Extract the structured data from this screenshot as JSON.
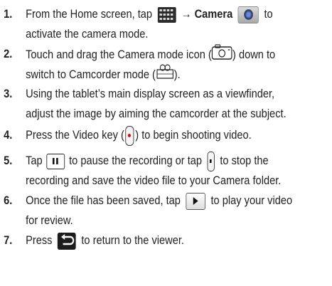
{
  "steps": [
    {
      "number": "1.",
      "line1_a": "From the Home screen, tap",
      "line1_arrow": "→",
      "line1_bold": "Camera",
      "line1_b": "to",
      "line2": "activate the camera mode."
    },
    {
      "number": "2.",
      "line1_a": "Touch and drag the Camera mode icon (",
      "line1_b": ") down to",
      "line2_a": "switch to Camcorder mode (",
      "line2_b": ")."
    },
    {
      "number": "3.",
      "line1": "Using the tablet’s main display screen as a viewfinder,",
      "line2": "adjust the image by aiming the camcorder at the subject."
    },
    {
      "number": "4.",
      "line1_a": "Press the Video key (",
      "line1_b": ") to begin shooting video."
    },
    {
      "number": "5.",
      "line1_a": "Tap",
      "line1_b": "to pause the recording or tap",
      "line1_c": "to stop the",
      "line2": "recording and save the video file to your Camera folder."
    },
    {
      "number": "6.",
      "line1_a": "Once the file has been saved, tap",
      "line1_b": "to play your video",
      "line2": "for review."
    },
    {
      "number": "7.",
      "line1_a": "Press",
      "line1_b": "to return to the viewer."
    }
  ],
  "icons": {
    "apps_grid": "apps-grid-icon",
    "camera_app": "camera-app-icon",
    "camera_mode": "camera-mode-icon",
    "camcorder_mode": "camcorder-mode-icon",
    "video_key": "video-key-icon",
    "pause": "pause-icon",
    "stop": "stop-key-icon",
    "play": "play-icon",
    "back": "back-icon"
  },
  "colors": {
    "text": "#222222",
    "record_dot": "#d01818",
    "camera_lens": "#3a5cc0"
  }
}
